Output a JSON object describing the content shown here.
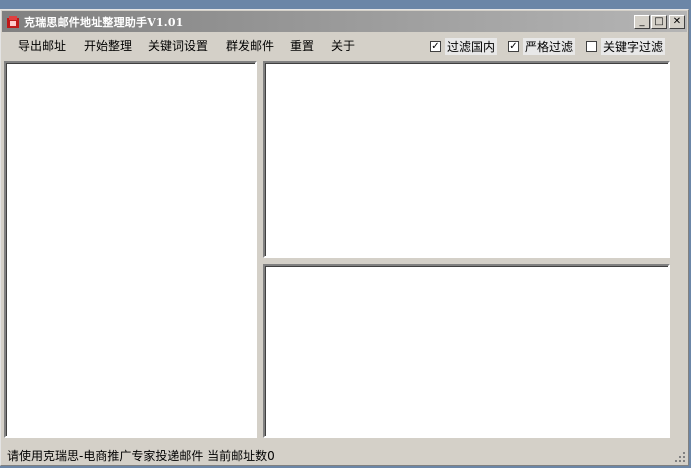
{
  "window": {
    "title": "克瑞思邮件地址整理助手V1.01"
  },
  "menu": {
    "items": [
      "导出邮址",
      "开始整理",
      "关键词设置",
      "群发邮件",
      "重置",
      "关于"
    ]
  },
  "filters": [
    {
      "label": "过滤国内",
      "checked": true
    },
    {
      "label": "严格过滤",
      "checked": true
    },
    {
      "label": "关键字过滤",
      "checked": false
    }
  ],
  "status": {
    "text": "请使用克瑞思-电商推广专家投递邮件 当前邮址数0"
  },
  "colors": {
    "desktop": "#6b86a7",
    "face": "#d4d0c8",
    "title_gradient_start": "#808080",
    "title_gradient_end": "#b5b5b5"
  }
}
